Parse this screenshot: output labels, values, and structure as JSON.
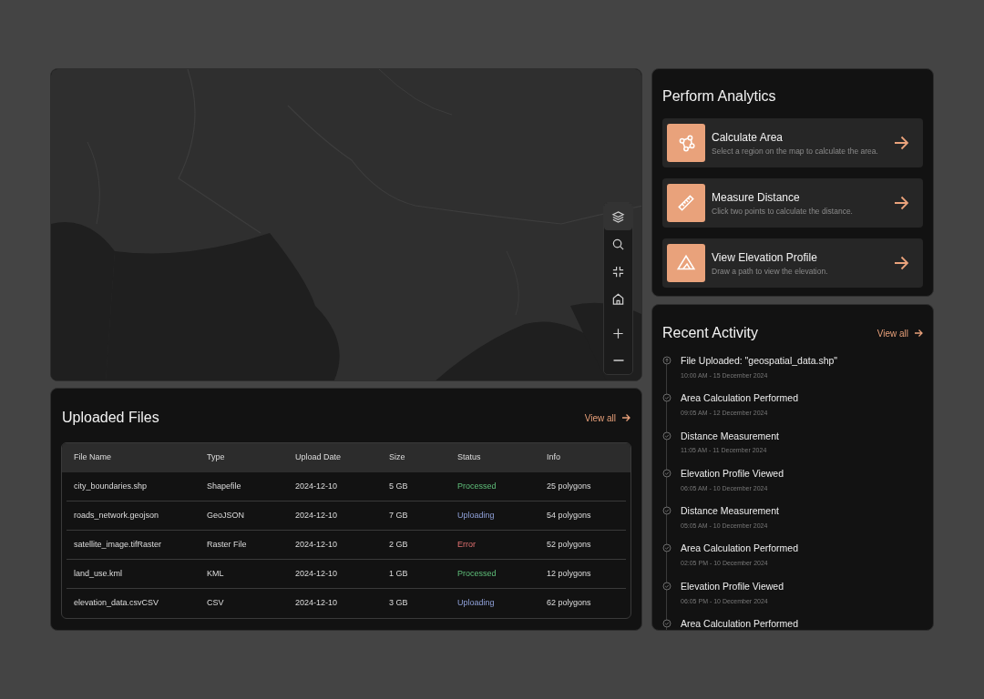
{
  "map": {
    "kind": "picture",
    "tools": [
      {
        "kind": "layers",
        "selected": true
      },
      {
        "kind": "search",
        "selected": false
      },
      {
        "kind": "collapse",
        "selected": false
      },
      {
        "kind": "home",
        "selected": false
      },
      {
        "kind": "zoom-in",
        "selected": false
      },
      {
        "kind": "zoom-out",
        "selected": false
      }
    ]
  },
  "uploaded_files": {
    "title": "Uploaded Files",
    "view_all": "View all",
    "columns": [
      "File Name",
      "Type",
      "Upload Date",
      "Size",
      "Status",
      "Info"
    ],
    "rows": [
      {
        "name": "city_boundaries.shp",
        "type": "Shapefile",
        "date": "2024-12-10",
        "size": "5 GB",
        "status": {
          "text": "Processed",
          "kind": "processed"
        },
        "info": "25 polygons"
      },
      {
        "name": "roads_network.geojson",
        "type": "GeoJSON",
        "date": "2024-12-10",
        "size": "7 GB",
        "status": {
          "text": "Uploading",
          "kind": "uploading"
        },
        "info": "54 polygons"
      },
      {
        "name": "satellite_image.tifRaster",
        "type": "Raster File",
        "date": "2024-12-10",
        "size": "2 GB",
        "status": {
          "text": "Error",
          "kind": "error"
        },
        "info": "52 polygons"
      },
      {
        "name": "land_use.kml",
        "type": "KML",
        "date": "2024-12-10",
        "size": "1 GB",
        "status": {
          "text": "Processed",
          "kind": "processed"
        },
        "info": "12 polygons"
      },
      {
        "name": "elevation_data.csvCSV",
        "type": "CSV",
        "date": "2024-12-10",
        "size": "3 GB",
        "status": {
          "text": "Uploading",
          "kind": "uploading"
        },
        "info": "62 polygons"
      }
    ]
  },
  "analytics": {
    "title": "Perform Analytics",
    "actions": [
      {
        "kind": "area",
        "title": "Calculate Area",
        "description": "Select a region on the map to calculate the area."
      },
      {
        "kind": "distance",
        "title": "Measure Distance",
        "description": "Click two points to calculate the distance."
      },
      {
        "kind": "elevation",
        "title": "View Elevation Profile",
        "description": "Draw a path to view the elevation."
      }
    ]
  },
  "recent_activity": {
    "title": "Recent Activity",
    "view_all": "View all",
    "items": [
      {
        "kind": "upload",
        "title": "File Uploaded: \"geospatial_data.shp\"",
        "time": "10:00 AM - 15 December 2024"
      },
      {
        "kind": "done",
        "title": "Area Calculation Performed",
        "time": "09:05 AM - 12 December 2024"
      },
      {
        "kind": "done",
        "title": "Distance Measurement",
        "time": "11:05 AM - 11 December 2024"
      },
      {
        "kind": "done",
        "title": "Elevation Profile Viewed",
        "time": "06:05 AM - 10 December 2024"
      },
      {
        "kind": "done",
        "title": "Distance Measurement",
        "time": "05:05 AM - 10 December 2024"
      },
      {
        "kind": "done",
        "title": "Area Calculation Performed",
        "time": "02:05 PM - 10 December 2024"
      },
      {
        "kind": "done",
        "title": "Elevation Profile Viewed",
        "time": "06:05 PM - 10 December 2024"
      },
      {
        "kind": "done",
        "title": "Area Calculation Performed"
      }
    ]
  }
}
